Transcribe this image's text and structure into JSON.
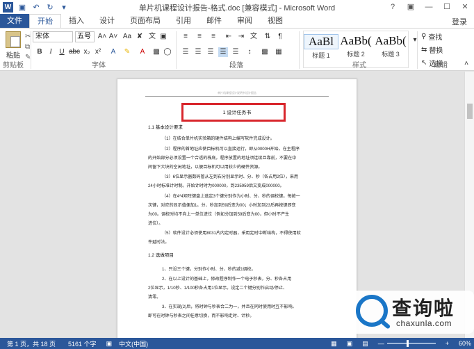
{
  "window": {
    "title": "单片机课程设计报告-格式.doc [兼容模式] - Microsoft Word",
    "controls": [
      "?",
      "▣",
      "—",
      "☐",
      "✕"
    ]
  },
  "tabs": [
    "文件",
    "开始",
    "插入",
    "设计",
    "页面布局",
    "引用",
    "邮件",
    "审阅",
    "视图"
  ],
  "login": "登录",
  "clipboard": {
    "paste": "粘贴",
    "label": "剪贴板"
  },
  "font": {
    "name": "宋体",
    "size": "五号",
    "label": "字体",
    "buttons": [
      "B",
      "I",
      "U",
      "abc",
      "x₂",
      "x²",
      "A",
      "Aa",
      "A"
    ]
  },
  "paragraph": {
    "label": "段落"
  },
  "styles": {
    "label": "样式",
    "items": [
      {
        "preview": "AaBl",
        "name": "标题 1"
      },
      {
        "preview": "AaBb(",
        "name": "标题 2"
      },
      {
        "preview": "AaBb(",
        "name": "标题 3"
      }
    ]
  },
  "editing": {
    "label": "编辑",
    "find": "查找",
    "replace": "替换",
    "select": "选择"
  },
  "document": {
    "header": "单片机课程设计说明书设计报告",
    "title": "1 设计任务书",
    "lines": [
      "1.1 基本设计要求",
      "（1）在结合单片机实验箱的硬件结构上编写软件完成设计。",
      "（2）程序的首地址应使目标机可以直接运行，即从0000H开始。在主程序",
      "的开始部分必须设置一个合适的栈底。程序放置的地址须连续且靠前，不要在中",
      "间留下大块的空闲地址，以便目标机可以用较少的硬件资源。",
      "（3）6位显示器数码管从左到右分别显示时、分、秒（各占用2位），采用",
      "24小时标准计时制。开始计时时为000000，到235959后又变成000000。",
      "（4）在4*4矩阵键盘上选定3个键分别作为小时、分、秒的调校键。每按一",
      "次键，对应的显示值便加1。分、秒加到59后变为00；小时加到23后再按键即变",
      "为00。调校时均不向上一单位进位（例如分加到59后变为00，但小时不产生",
      "进位）。",
      "（5）软件设计必须使用8031片内定时器，采用定时中断结构，不得使用软",
      "件延时法。",
      "1.2 选做项目",
      "1、只设三个键，分别作小时、分、秒的减1调校。",
      "2、在以上设计的基础上，修改程序制作一个电子秒表，分、秒各占用",
      "2位显示，1/10秒、1/100秒各占用1位显示。设定二个键分别作启动/停止、",
      "清零。",
      "3、在实现(2)后，将时钟与秒表合二为一，并且在同时使用时互不影响。",
      "即可在时钟与秒表之间任意切换，而不影响走时、计秒。"
    ]
  },
  "status": {
    "page": "第 1 页，共 18 页",
    "words": "5161 个字",
    "lang": "中文(中国)",
    "zoom": "60%"
  },
  "watermark": {
    "brand": "查询啦",
    "domain": "chaxunla.com"
  }
}
